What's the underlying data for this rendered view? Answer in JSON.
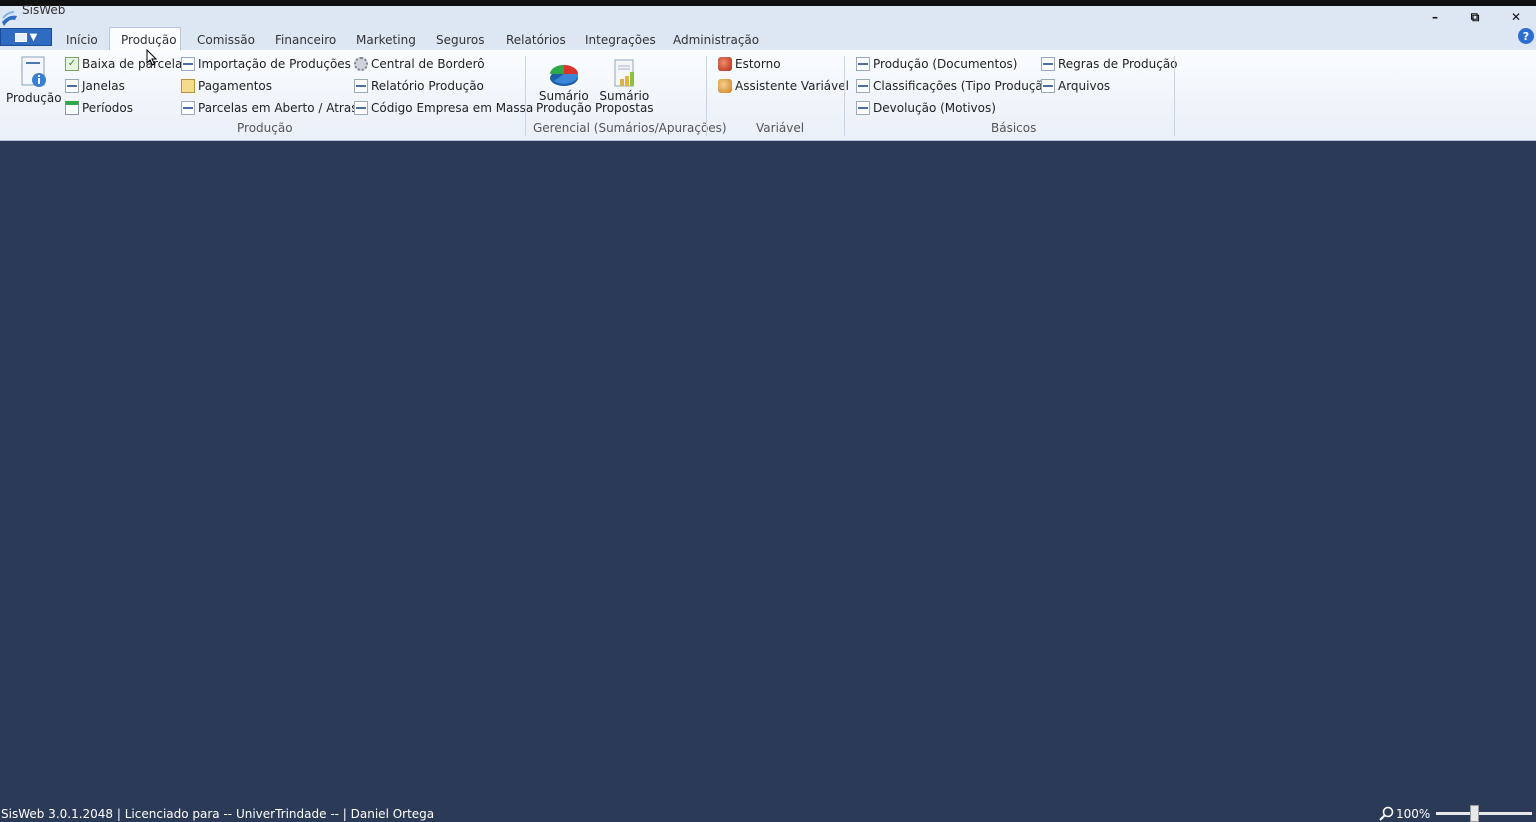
{
  "window": {
    "title": "SisWeb"
  },
  "tabs": [
    {
      "label": "Início"
    },
    {
      "label": "Produção"
    },
    {
      "label": "Comissão"
    },
    {
      "label": "Financeiro"
    },
    {
      "label": "Marketing"
    },
    {
      "label": "Seguros"
    },
    {
      "label": "Relatórios"
    },
    {
      "label": "Integrações"
    },
    {
      "label": "Administração"
    }
  ],
  "active_tab": "Produção",
  "ribbon": {
    "producao_group": {
      "label": "Produção",
      "big_button": "Produção",
      "items": [
        "Baixa de parcelas",
        "Janelas",
        "Períodos",
        "Importação de Produções",
        "Pagamentos",
        "Parcelas em Aberto / Atraso",
        "Central de Borderô",
        "Relatório Produção",
        "Código Empresa em Massa"
      ]
    },
    "gerencial_group": {
      "label": "Gerencial (Sumários/Apurações)",
      "buttons": [
        {
          "line1": "Sumário",
          "line2": "Produção"
        },
        {
          "line1": "Sumário",
          "line2": "Propostas"
        }
      ]
    },
    "variavel_group": {
      "label": "Variável",
      "items": [
        "Estorno",
        "Assistente Variável"
      ]
    },
    "basicos_group": {
      "label": "Básicos",
      "items": [
        "Produção (Documentos)",
        "Classificações (Tipo Produção)",
        "Devolução (Motivos)",
        "Regras de Produção",
        "Arquivos"
      ]
    }
  },
  "status": {
    "text": "SisWeb 3.0.1.2048 | Licenciado para -- UniverTrindade -- | Daniel Ortega",
    "zoom": "100%"
  },
  "colors": {
    "workspace": "#2b3a57",
    "ribbon": "#eaf0f8",
    "tabbar": "#dde7f3",
    "app_menu": "#2f6bc0"
  }
}
